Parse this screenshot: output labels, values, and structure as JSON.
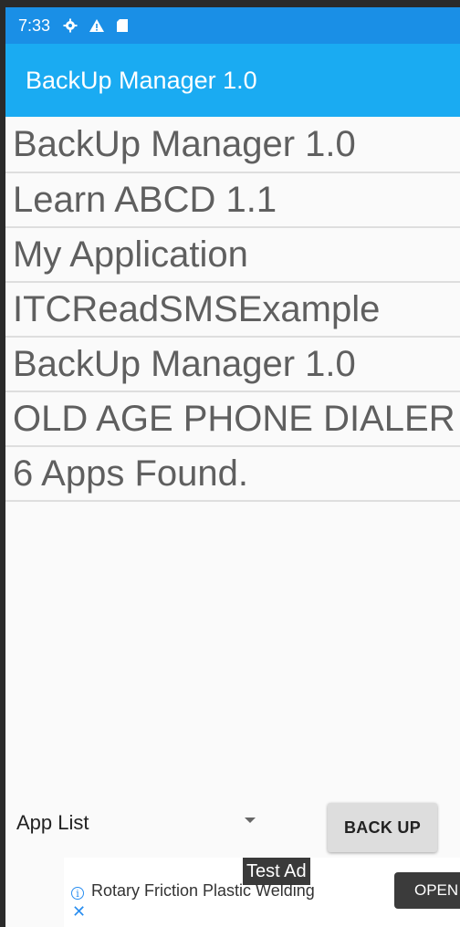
{
  "status_bar": {
    "time": "7:33",
    "icons": [
      "gear-icon",
      "warning-icon",
      "sd-card-icon"
    ]
  },
  "app_bar": {
    "title": "BackUp Manager 1.0"
  },
  "app_list": {
    "items": [
      "BackUp Manager 1.0",
      "Learn ABCD 1.1",
      "My Application",
      "ITCReadSMSExample",
      "BackUp Manager 1.0",
      "OLD AGE PHONE DIALER",
      "6 Apps Found."
    ]
  },
  "controls": {
    "spinner_value": "App List",
    "backup_label": "BACK UP"
  },
  "ad": {
    "label": "Test Ad",
    "text": "Rotary Friction Plastic Welding",
    "open_label": "OPEN"
  },
  "colors": {
    "status_bar": "#1a8fe6",
    "app_bar": "#1aabf2",
    "list_text": "#5f5f5f"
  }
}
